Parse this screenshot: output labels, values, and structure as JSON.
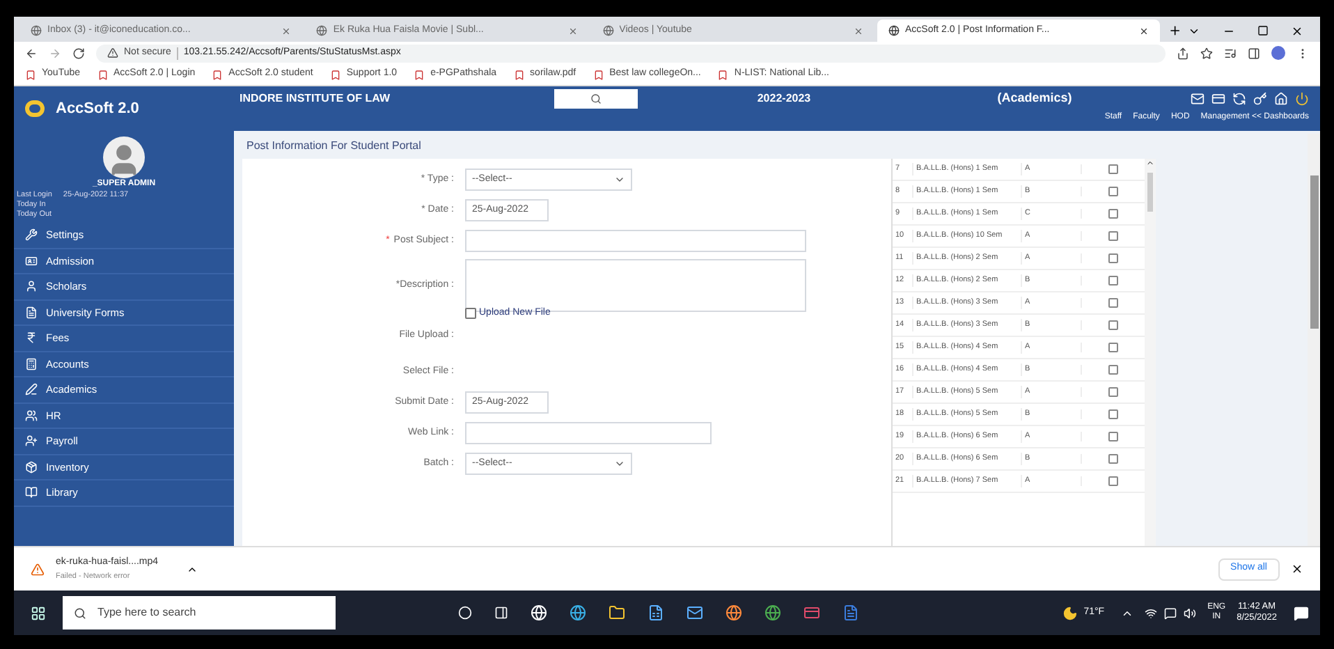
{
  "browser": {
    "tabs": [
      {
        "title": "Inbox (3) - it@iconeducation.co...",
        "selected": false
      },
      {
        "title": "Ek Ruka Hua Faisla Movie | Subl...",
        "selected": false
      },
      {
        "title": "Videos | Youtube",
        "selected": false
      },
      {
        "title": "AccSoft 2.0 | Post Information F...",
        "selected": true
      }
    ],
    "security": "Not secure",
    "url": "103.21.55.242/Accsoft/Parents/StuStatusMst.aspx",
    "bookmarks": [
      "YouTube",
      "AccSoft 2.0 | Login",
      "AccSoft 2.0 student",
      "Support 1.0",
      "e-PGPathshala",
      "sorilaw.pdf",
      "Best law collegeOn...",
      "N-LIST: National Lib..."
    ]
  },
  "header": {
    "logo": "AccSoft 2.0",
    "institute": "INDORE INSTITUTE OF LAW",
    "session": "2022-2023",
    "module": "(Academics)",
    "links": [
      "Staff",
      "Faculty",
      "HOD",
      "Management << Dashboards"
    ]
  },
  "sidebar": {
    "user": "_SUPER ADMIN",
    "info": [
      {
        "label": "Last Login",
        "value": "25-Aug-2022 11:37"
      },
      {
        "label": "Today In"
      },
      {
        "label": "Today Out"
      }
    ],
    "items": [
      "Settings",
      "Admission",
      "Scholars",
      "University Forms",
      "Fees",
      "Accounts",
      "Academics",
      "HR",
      "Payroll",
      "Inventory",
      "Library"
    ]
  },
  "form": {
    "title": "Post Information For Student Portal",
    "fields": [
      {
        "kind": "select",
        "label": "* Type :",
        "value": "--Select--"
      },
      {
        "kind": "short",
        "label": "* Date :",
        "value": "25-Aug-2022"
      },
      {
        "kind": "text",
        "label": "Post Subject :",
        "mark": "*"
      },
      {
        "kind": "textarea",
        "label": "*Description :"
      },
      {
        "kind": "checkbox",
        "label": "File Upload :",
        "option": "Upload New File",
        "checked": false
      },
      {
        "kind": "none",
        "label": "Select File :"
      },
      {
        "kind": "short",
        "label": "Submit Date :",
        "value": "25-Aug-2022"
      },
      {
        "kind": "medium",
        "label": "Web Link :"
      },
      {
        "kind": "select",
        "label": "Batch :",
        "value": "--Select--"
      }
    ]
  },
  "batch_table": {
    "rows": [
      {
        "no": "7",
        "course": "B.A.LL.B. (Hons) 1 Sem",
        "section": "A",
        "checked": false
      },
      {
        "no": "8",
        "course": "B.A.LL.B. (Hons) 1 Sem",
        "section": "B",
        "checked": false
      },
      {
        "no": "9",
        "course": "B.A.LL.B. (Hons) 1 Sem",
        "section": "C",
        "checked": false
      },
      {
        "no": "10",
        "course": "B.A.LL.B. (Hons) 10 Sem",
        "section": "A",
        "checked": false
      },
      {
        "no": "11",
        "course": "B.A.LL.B. (Hons) 2 Sem",
        "section": "A",
        "checked": false
      },
      {
        "no": "12",
        "course": "B.A.LL.B. (Hons) 2 Sem",
        "section": "B",
        "checked": false
      },
      {
        "no": "13",
        "course": "B.A.LL.B. (Hons) 3 Sem",
        "section": "A",
        "checked": false
      },
      {
        "no": "14",
        "course": "B.A.LL.B. (Hons) 3 Sem",
        "section": "B",
        "checked": false
      },
      {
        "no": "15",
        "course": "B.A.LL.B. (Hons) 4 Sem",
        "section": "A",
        "checked": false
      },
      {
        "no": "16",
        "course": "B.A.LL.B. (Hons) 4 Sem",
        "section": "B",
        "checked": false
      },
      {
        "no": "17",
        "course": "B.A.LL.B. (Hons) 5 Sem",
        "section": "A",
        "checked": false
      },
      {
        "no": "18",
        "course": "B.A.LL.B. (Hons) 5 Sem",
        "section": "B",
        "checked": false
      },
      {
        "no": "19",
        "course": "B.A.LL.B. (Hons) 6 Sem",
        "section": "A",
        "checked": false
      },
      {
        "no": "20",
        "course": "B.A.LL.B. (Hons) 6 Sem",
        "section": "B",
        "checked": false
      },
      {
        "no": "21",
        "course": "B.A.LL.B. (Hons) 7 Sem",
        "section": "A",
        "checked": false
      }
    ]
  },
  "download_bar": {
    "file": "ek-ruka-hua-faisl....mp4",
    "status": "Failed - Network error",
    "show_all": "Show all"
  },
  "taskbar": {
    "search_placeholder": "Type here to search",
    "weather": "71°F",
    "language": "ENG",
    "region": "IN",
    "time": "11:42 AM",
    "date": "8/25/2022"
  }
}
